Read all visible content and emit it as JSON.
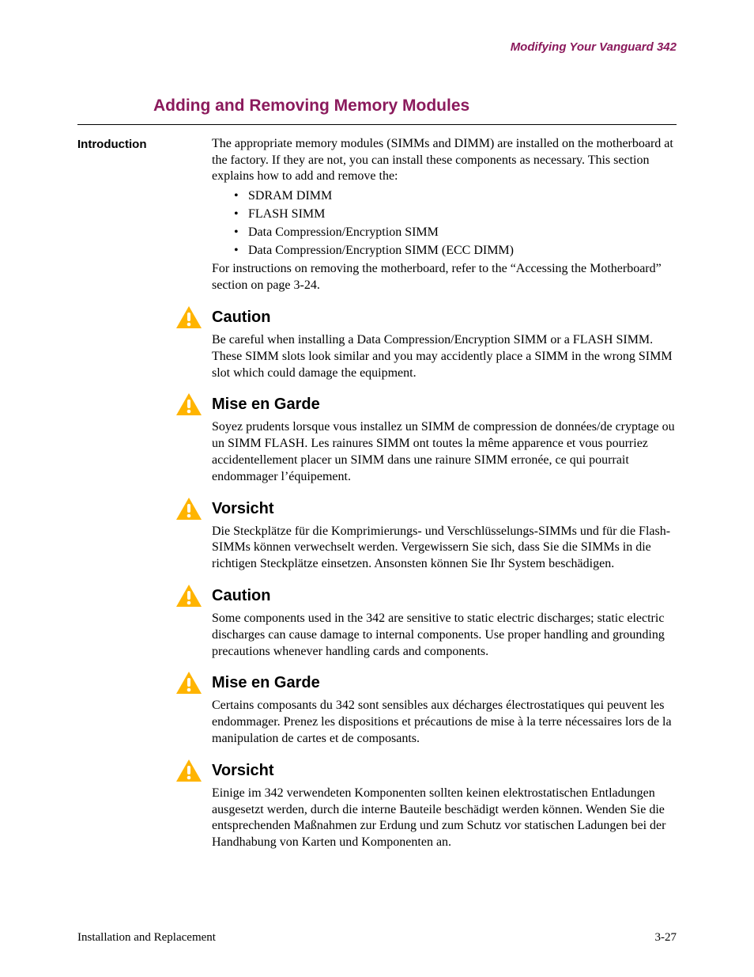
{
  "header": {
    "right": "Modifying Your Vanguard 342"
  },
  "section": {
    "title": "Adding and Removing Memory Modules",
    "side_label": "Introduction",
    "intro_para1": "The appropriate memory modules (SIMMs and DIMM) are installed on the motherboard at the factory. If they are not, you can install these components as necessary. This section explains how to add and remove the:",
    "bullets": [
      "SDRAM DIMM",
      "FLASH SIMM",
      "Data Compression/Encryption SIMM",
      "Data Compression/Encryption SIMM (ECC DIMM)"
    ],
    "intro_para2": "For instructions on removing the motherboard, refer to the “Accessing the Motherboard” section on page 3-24."
  },
  "cautions": [
    {
      "title": "Caution",
      "text": "Be careful when installing a Data Compression/Encryption SIMM or a FLASH SIMM. These SIMM slots look similar and you may accidently place a SIMM in the wrong SIMM slot which could damage the equipment."
    },
    {
      "title": "Mise en Garde",
      "text": "Soyez prudents lorsque vous installez un SIMM de compression de données/de cryptage ou un SIMM FLASH. Les rainures SIMM ont toutes la même apparence et vous pourriez accidentellement placer un SIMM dans une rainure SIMM erronée, ce qui pourrait endommager l’équipement."
    },
    {
      "title": "Vorsicht",
      "text": "Die Steckplätze für die Komprimierungs- und Verschlüsselungs-SIMMs und für die Flash-SIMMs können verwechselt werden. Vergewissern Sie sich, dass Sie die SIMMs in die richtigen Steckplätze einsetzen. Ansonsten können Sie Ihr System beschädigen."
    },
    {
      "title": "Caution",
      "text": "Some components used in the 342 are sensitive to static electric discharges; static electric discharges can cause damage to internal components. Use proper handling and grounding precautions whenever handling cards and components."
    },
    {
      "title": "Mise en Garde",
      "text": "Certains composants du 342 sont sensibles aux décharges électrostatiques qui peuvent les endommager. Prenez les dispositions et précautions de mise à la terre nécessaires lors de la manipulation de cartes et de composants."
    },
    {
      "title": "Vorsicht",
      "text": "Einige im 342 verwendeten Komponenten sollten keinen elektrostatischen Entladungen ausgesetzt werden, durch die interne Bauteile beschädigt werden können. Wenden Sie die entsprechenden Maßnahmen zur Erdung und zum Schutz vor statischen Ladungen bei der Handhabung von Karten und Komponenten an."
    }
  ],
  "footer": {
    "left": "Installation and Replacement",
    "right": "3-27"
  }
}
